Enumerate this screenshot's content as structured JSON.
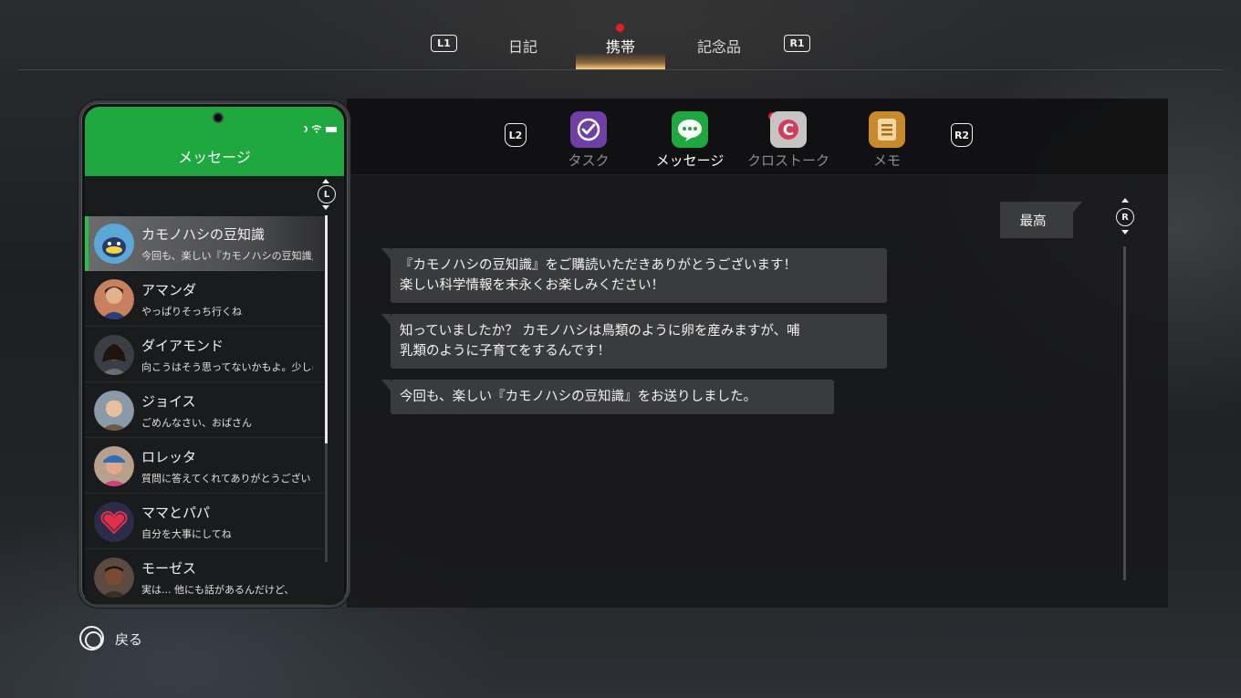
{
  "top_tabs": {
    "left_button": "L1",
    "right_button": "R1",
    "items": [
      {
        "label": "日記"
      },
      {
        "label": "携帯",
        "active": true,
        "notification": true
      },
      {
        "label": "記念品"
      }
    ]
  },
  "app_bar": {
    "left_button": "L2",
    "right_button": "R2",
    "apps": [
      {
        "label": "タスク",
        "icon": "task-check-icon",
        "color": "#6f3fa6"
      },
      {
        "label": "メッセージ",
        "icon": "message-bubble-icon",
        "color": "#1fa83f",
        "active": true
      },
      {
        "label": "クロストーク",
        "icon": "crosstalk-icon",
        "color": "#c8c4c4",
        "notification": true
      },
      {
        "label": "メモ",
        "icon": "memo-icon",
        "color": "#c98a2e"
      }
    ]
  },
  "phone": {
    "title": "メッセージ",
    "stick": "L",
    "contacts": [
      {
        "name": "カモノハシの豆知識",
        "preview": "今回も、楽しい『カモノハシの豆知識』をお送りしました。",
        "avatar": "platypus-avatar",
        "active": true
      },
      {
        "name": "アマンダ",
        "preview": "やっぱりそっち行くね",
        "avatar": "amanda-avatar"
      },
      {
        "name": "ダイアモンド",
        "preview": "向こうはそう思ってないかもよ。少しは",
        "avatar": "diamond-avatar"
      },
      {
        "name": "ジョイス",
        "preview": "ごめんなさい、おばさん",
        "avatar": "joyce-avatar"
      },
      {
        "name": "ロレッタ",
        "preview": "質問に答えてくれてありがとうござい",
        "avatar": "loretta-avatar"
      },
      {
        "name": "ママとパパ",
        "preview": "自分を大事にしてね",
        "avatar": "heart-avatar"
      },
      {
        "name": "モーゼス",
        "preview": "実は... 他にも話があるんだけど、",
        "avatar": "moses-avatar"
      }
    ]
  },
  "chat": {
    "sort_label": "最高",
    "stick": "R",
    "messages": [
      {
        "line1": "『カモノハシの豆知識』をご購読いただきありがとうございます！",
        "line2": "楽しい科学情報を末永くお楽しみください！"
      },
      {
        "line1": "知っていましたか？ カモノハシは鳥類のように卵を産みますが、哺",
        "line2": "乳類のように子育てをするんです！"
      },
      {
        "line1": "今回も、楽しい『カモノハシの豆知識』をお送りしました。",
        "line2": ""
      }
    ]
  },
  "footer": {
    "back_label": "戻る"
  },
  "colors": {
    "accent_green": "#1fa83f",
    "notification_red": "#e51d1d"
  }
}
